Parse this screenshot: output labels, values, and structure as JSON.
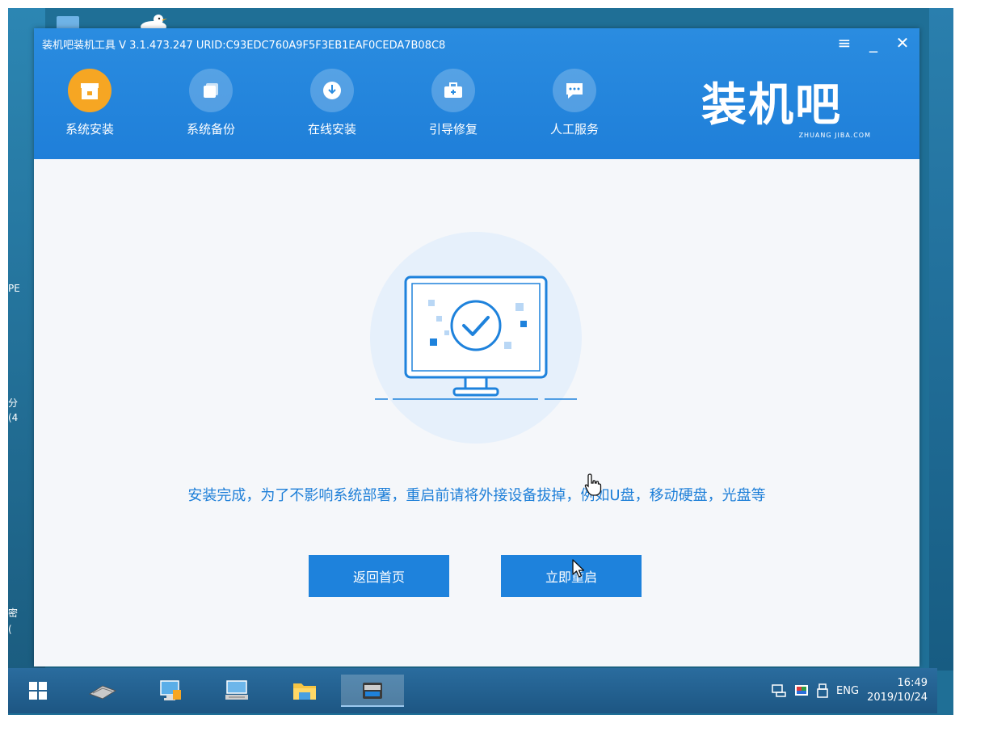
{
  "window": {
    "title": "装机吧装机工具 V 3.1.473.247 URID:C93EDC760A9F5F3EB1EAF0CEDA7B08C8",
    "menu_icon": "menu-icon",
    "minimize_icon": "minimize-icon",
    "close_icon": "close-icon"
  },
  "nav": {
    "items": [
      {
        "label": "系统安装",
        "icon": "install-icon",
        "active": true
      },
      {
        "label": "系统备份",
        "icon": "backup-icon"
      },
      {
        "label": "在线安装",
        "icon": "download-icon"
      },
      {
        "label": "引导修复",
        "icon": "repair-icon"
      },
      {
        "label": "人工服务",
        "icon": "chat-icon"
      }
    ]
  },
  "brand": {
    "main": "装机吧",
    "sub": "ZHUANG JIBA.COM"
  },
  "desktop": {
    "labels": [
      "PE",
      "分",
      "(4",
      "密",
      "("
    ]
  },
  "content": {
    "message": "安装完成，为了不影响系统部署，重启前请将外接设备拔掉，例如U盘，移动硬盘，光盘等",
    "back_button": "返回首页",
    "restart_button": "立即重启"
  },
  "taskbar": {
    "tray": {
      "lang": "ENG",
      "time": "16:49",
      "date": "2019/10/24"
    }
  },
  "colors": {
    "accent": "#1e82dc",
    "header": "#2a8ce0",
    "active_tab": "#f6a623"
  }
}
